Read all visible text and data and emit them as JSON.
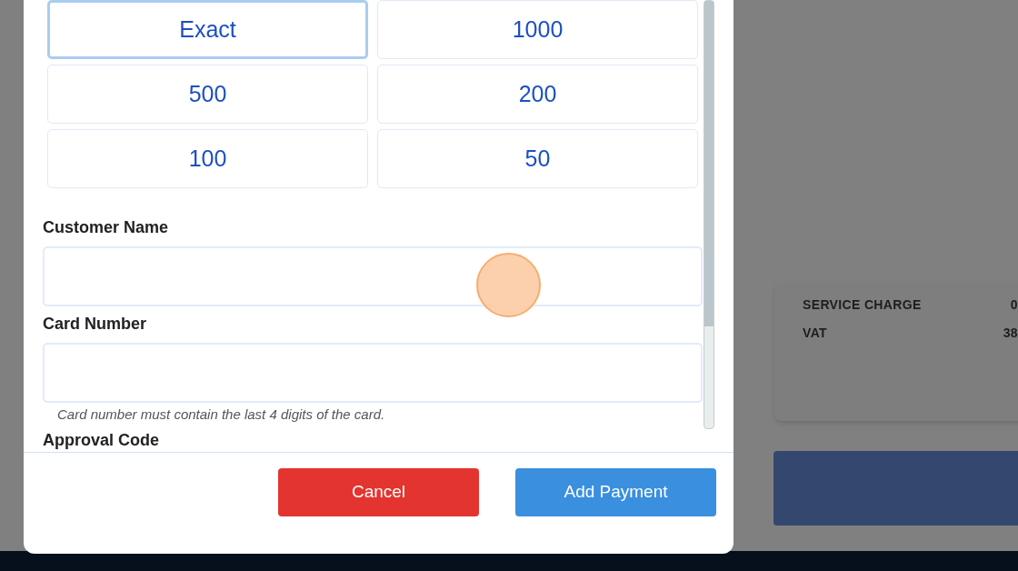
{
  "background": {
    "summary": [
      {
        "label": "SERVICE CHARGE",
        "value": "0"
      },
      {
        "label": "VAT",
        "value": "38"
      }
    ]
  },
  "dialog": {
    "amounts": [
      {
        "label": "Exact",
        "selected": true
      },
      {
        "label": "1000",
        "selected": false
      },
      {
        "label": "500",
        "selected": false
      },
      {
        "label": "200",
        "selected": false
      },
      {
        "label": "100",
        "selected": false
      },
      {
        "label": "50",
        "selected": false
      }
    ],
    "fields": [
      {
        "label": "Customer Name",
        "kind": "input"
      },
      {
        "label": "Card Number",
        "kind": "input",
        "hint": "Card number must contain the last 4 digits of the card."
      },
      {
        "label": "Approval Code",
        "kind": "label-only"
      }
    ],
    "buttons": [
      {
        "label": "Cancel",
        "kind": "danger"
      },
      {
        "label": "Add Payment",
        "kind": "primary"
      }
    ]
  }
}
